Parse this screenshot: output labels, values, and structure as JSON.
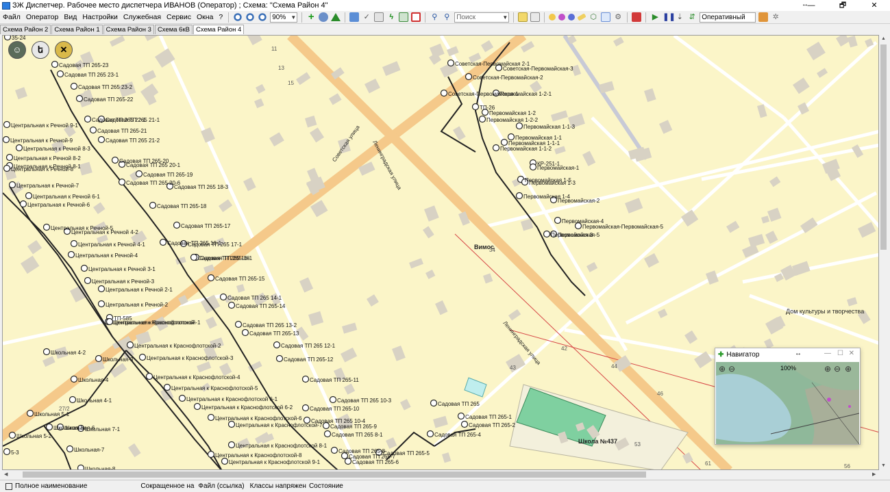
{
  "window": {
    "title": "ЗЖ Диспетчер. Рабочее место диспетчера ИВАНОВ (Оператор) ; Схема: \"Схема Район 4\"",
    "resize_glyph": "↔",
    "minimize": "—",
    "maximize": "🗗",
    "close": "✕"
  },
  "menu": [
    "Файл",
    "Оператор",
    "Вид",
    "Настройки",
    "Служебная",
    "Сервис",
    "Окна",
    "?"
  ],
  "toolbar": {
    "zoom_value": "90%",
    "search_placeholder": "Поиск",
    "mode_value": "Оперативный",
    "icons": [
      "zoom-in-icon",
      "zoom-out-icon",
      "zoom-fit-icon",
      "add-green-icon",
      "search-globe-icon",
      "triangle-icon",
      "edit-icon",
      "check-icon",
      "lightning-icon",
      "print-icon",
      "table-icon",
      "binoculars-icon",
      "binoculars-find-icon",
      "layers-icon",
      "grid-icon",
      "cursor-icon",
      "purple-dot-icon",
      "blue-dot-icon",
      "eraser-icon",
      "shape-icon",
      "window-icon",
      "gear-icon",
      "flag-red-icon",
      "play-green-icon",
      "pause-icon",
      "step-icon",
      "chart-icon",
      "palette-icon",
      "settings-icon"
    ]
  },
  "tabs": [
    {
      "label": "Схема Район 2",
      "active": false
    },
    {
      "label": "Схема Район 1",
      "active": false
    },
    {
      "label": "Схема Район 3",
      "active": false
    },
    {
      "label": "Схема 6кВ",
      "active": false
    },
    {
      "label": "Схема Район 4",
      "active": true
    }
  ],
  "map": {
    "street_labels": [
      "Советская улица",
      "Ленинградская улица",
      "Ленинградская улица"
    ],
    "places": [
      "Вимос",
      "Дом культуры и творчества",
      "Школа №437"
    ],
    "house_numbers": [
      "11",
      "13",
      "15",
      "34",
      "42",
      "43",
      "44",
      "46",
      "53",
      "61",
      "56",
      "27/2"
    ],
    "nodes_left": [
      "35-24",
      "Садовая ТП 265-23",
      "Садовая ТП 265 23-1",
      "Садовая ТП 265 23-2",
      "Садовая ТП 265-22",
      "Садовая ТП 265 22-1",
      "Садовая ТП 265 21-1",
      "Садовая ТП 265-21",
      "Садовая ТП 265 21-2",
      "Садовая ТП 265-20",
      "Садовая ТП 265 20-1",
      "Садовая ТП 265-19",
      "Садовая ТП 265 20-6",
      "Садовая ТП 265 18-3",
      "Садовая ТП 265-18",
      "Садовая ТП 265-17",
      "Садовая ТП 265 18-1",
      "Садовая ТП 265 17-1",
      "Садовая ТП 265-16",
      "Садовая ТП 265 16-1",
      "Садовая ТП 265-15",
      "Садовая ТП 265 14-1",
      "Садовая ТП 265-14",
      "Садовая ТП 265 13-2",
      "Садовая ТП 265-13",
      "Садовая ТП 265 12-1",
      "Садовая ТП 265-12",
      "Садовая ТП 265-11",
      "Садовая ТП 265 10-3",
      "Садовая ТП 265-10",
      "Садовая ТП 265 10-4",
      "Садовая ТП 265-9",
      "Садовая ТП 265 8-1",
      "Садовая ТП 265-8",
      "Садовая ТП 265-7",
      "Садовая ТП 265-6",
      "Садовая ТП 265-5",
      "Садовая ТП 265-4",
      "Садовая ТП 265",
      "Садовая ТП 265-1",
      "Садовая ТП 265-2"
    ],
    "nodes_center": [
      "Центральная к Речной 9-1",
      "Центральная к Речной-9",
      "Центральная к Речной 8-3",
      "Центральная к Речной 8-2",
      "Центральная к Речной 8-1",
      "Центральная к Речной-8",
      "Центральная к Речной-7",
      "Центральная к Речной 6-1",
      "Центральная к Речной-6",
      "Центральная к Речной-5",
      "Центральная к Речной 4-2",
      "Центральная к Речной 4-1",
      "Центральная к Речной-4",
      "Центральная к Речной 3-1",
      "Центральная к Речной-3",
      "Центральная к Речной 2-1",
      "Центральная к Речной-2",
      "ТП-585",
      "Центральная к Краснофлотской",
      "Центральная к Краснофлотской-1",
      "Центральная к Краснофлотской-2",
      "Центральная к Краснофлотской-3",
      "Центральная к Краснофлотской-4",
      "Центральная к Краснофлотской-5",
      "Центральная к Краснофлотской 6-1",
      "Центральная к Краснофлотской 6-2",
      "Центральная к Краснофлотской-6",
      "Центральная к Краснофлотской-7",
      "Центральная к Краснофлотской 8-1",
      "Центральная к Краснофлотской-8",
      "Центральная к Краснофлотской 9-1"
    ],
    "nodes_school": [
      "Школьная 4-2",
      "Школьная-3",
      "Школьная-4",
      "Школьная 4-1",
      "Школьная-5",
      "Школьная 5-1",
      "Школьная-6",
      "Школьная 7-1",
      "Школьная-7",
      "Школьная-8",
      "Школьная 5-2",
      "5-3"
    ],
    "nodes_right": [
      "Советская-Первомайская 2-1",
      "Советская-Первомайская-3",
      "Советская-Первомайская-2",
      "Советская-Первомайская-1",
      "Первомайская 1-2-1",
      "ТП-26",
      "Первомайская 1-2",
      "Первомайская 1-2-2",
      "Первомайская 1-1-3",
      "Первомайская 1-1",
      "Первомайская 1-1-1",
      "Первомайская 1-1-2",
      "КР-251-1",
      "Первомайская-1",
      "Первомайская 1-5",
      "Первомайская 1-3",
      "Первомайская 1-4",
      "Первомайская-2",
      "Первомайская-4",
      "Первомайская-Первомайская-5",
      "Первомайская-3",
      "Первомайская-5"
    ]
  },
  "navigator": {
    "title": "Навигатор",
    "zoom": "100%"
  },
  "statusbar": {
    "full_name": "Полное наименование",
    "short_name": "Сокращенное на",
    "file_link": "Файл (ссылка)",
    "voltage_classes": "Классы напряжен",
    "state": "Состояние"
  }
}
